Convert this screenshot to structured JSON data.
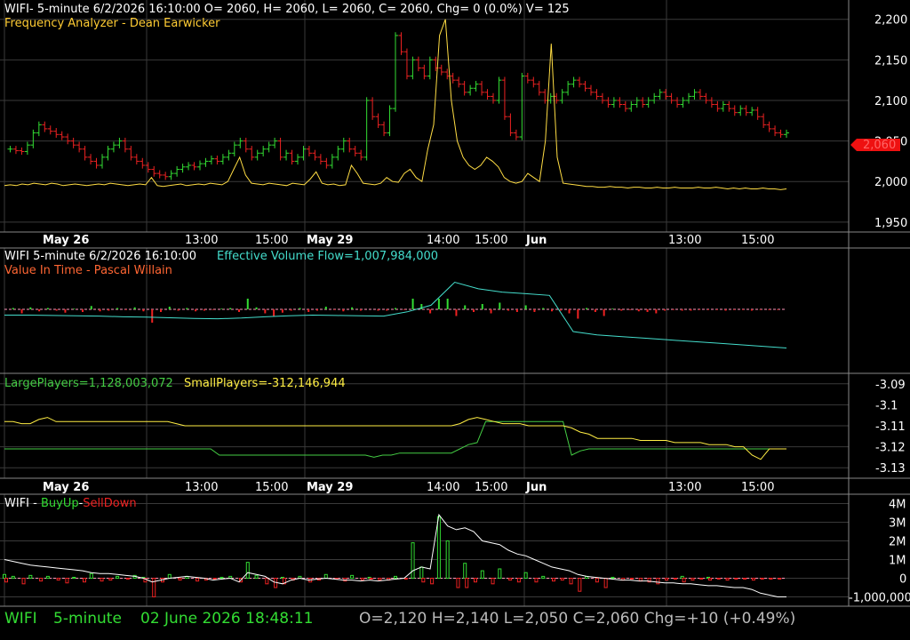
{
  "colors": {
    "background": "#000000",
    "up": "#33dd33",
    "down": "#ee2222",
    "grid": "#3a3a3a",
    "axis_text": "#ffffff",
    "freq": "#ffdd44",
    "flow": "#44ddcc",
    "value_in_time": "#ff6633",
    "large": "#44cc44",
    "small": "#ffee44",
    "buyup": "#33dd33",
    "selldown": "#ee2222",
    "cumulative": "#ffffff",
    "status_green": "#33dd33",
    "status_grey": "#bbbbbb",
    "price_tag": "#ee1111"
  },
  "panel1": {
    "header": "WIFI- 5-minute 6/2/2026 16:10:00 O= 2060, H= 2060, L= 2060, C= 2060, Chg= 0 (0.0%) V= 125",
    "indicator": "Frequency Analyzer - Dean Earwicker",
    "price_tag": "2,060",
    "y_ticks": [
      "2,200",
      "2,150",
      "2,100",
      "2,050",
      "2,000",
      "1,950"
    ]
  },
  "time_axis": {
    "major": [
      "May 26",
      "May 29",
      "Jun"
    ],
    "minor": [
      "13:00",
      "15:00",
      "14:00",
      "15:00",
      "13:00",
      "15:00"
    ]
  },
  "panel2": {
    "header_left": "WIFI 5-minute  6/2/2026 16:10:00",
    "header_right": "Effective Volume Flow=1,007,984,000",
    "indicator": "Value In Time - Pascal Willain"
  },
  "panel3": {
    "large_label": "LargePlayers=1,128,003,072",
    "small_label": "SmallPlayers=-312,146,944",
    "y_ticks": [
      "-3.09",
      "-3.1",
      "-3.11",
      "-3.12",
      "-3.13"
    ]
  },
  "panel4": {
    "header_prefix": "WIFI - ",
    "buy_label": "BuyUp",
    "dash": "-",
    "sell_label": "SellDown",
    "y_ticks": [
      "4M",
      "3M",
      "2M",
      "1M",
      "0",
      "-1,000,000"
    ]
  },
  "status": {
    "symbol": "WIFI",
    "interval": "5-minute",
    "datetime": "02 June 2026 18:48:11",
    "ohlc": "O=2,120  H=2,140  L=2,050  C=2,060  Chg=+10 (+0.49%)"
  },
  "chart_data": [
    {
      "type": "ohlc",
      "title": "WIFI 5-minute",
      "ylim": [
        1940,
        2215
      ],
      "x_labels": [
        "May 26",
        "13:00",
        "15:00",
        "May 29",
        "14:00",
        "15:00",
        "Jun",
        "13:00",
        "15:00"
      ],
      "close_series": [
        2040,
        2040,
        2038,
        2037,
        2045,
        2060,
        2070,
        2065,
        2062,
        2058,
        2055,
        2050,
        2045,
        2040,
        2030,
        2025,
        2020,
        2030,
        2040,
        2045,
        2050,
        2040,
        2030,
        2025,
        2020,
        2015,
        2010,
        2008,
        2006,
        2010,
        2015,
        2018,
        2020,
        2018,
        2022,
        2025,
        2028,
        2025,
        2030,
        2035,
        2045,
        2050,
        2040,
        2030,
        2035,
        2040,
        2045,
        2050,
        2030,
        2035,
        2025,
        2030,
        2040,
        2035,
        2030,
        2025,
        2020,
        2030,
        2040,
        2050,
        2040,
        2035,
        2030,
        2100,
        2080,
        2070,
        2060,
        2090,
        2180,
        2160,
        2130,
        2150,
        2140,
        2130,
        2150,
        2140,
        2135,
        2130,
        2125,
        2120,
        2110,
        2115,
        2120,
        2110,
        2105,
        2100,
        2125,
        2080,
        2060,
        2055,
        2130,
        2125,
        2120,
        2110,
        2100,
        2105,
        2100,
        2110,
        2120,
        2125,
        2120,
        2115,
        2110,
        2105,
        2100,
        2095,
        2100,
        2095,
        2090,
        2095,
        2100,
        2095,
        2100,
        2105,
        2110,
        2105,
        2100,
        2095,
        2100,
        2105,
        2110,
        2105,
        2100,
        2095,
        2090,
        2095,
        2090,
        2085,
        2090,
        2085,
        2088,
        2080,
        2070,
        2065,
        2060,
        2058,
        2060
      ],
      "freq_series": [
        1995,
        1996,
        1995,
        1997,
        1996,
        1998,
        1997,
        1996,
        1998,
        1997,
        1995,
        1996,
        1997,
        1996,
        1995,
        1996,
        1997,
        1996,
        1998,
        1997,
        1996,
        1995,
        1996,
        1997,
        1996,
        2005,
        1995,
        1994,
        1995,
        1996,
        1997,
        1995,
        1996,
        1997,
        1996,
        1998,
        1997,
        1996,
        2000,
        2015,
        2030,
        2008,
        1998,
        1997,
        1996,
        1998,
        1997,
        1996,
        1995,
        1998,
        1997,
        1996,
        2003,
        2012,
        1998,
        1996,
        1997,
        1995,
        1996,
        2020,
        2010,
        1998,
        1997,
        1996,
        1998,
        2005,
        2000,
        1999,
        2010,
        2015,
        2005,
        2000,
        2040,
        2070,
        2180,
        2200,
        2100,
        2050,
        2030,
        2020,
        2015,
        2020,
        2030,
        2025,
        2018,
        2005,
        2000,
        1998,
        2000,
        2010,
        2005,
        2000,
        2050,
        2170,
        2030,
        1998,
        1997,
        1996,
        1995,
        1994,
        1994,
        1993,
        1993,
        1994,
        1993,
        1993,
        1992,
        1993,
        1993,
        1992,
        1992,
        1993,
        1992,
        1992,
        1993,
        1992,
        1992,
        1992,
        1993,
        1992,
        1992,
        1993,
        1992,
        1991,
        1992,
        1991,
        1992,
        1991,
        1991,
        1992,
        1991,
        1991,
        1990,
        1991
      ]
    },
    {
      "type": "line",
      "title": "Effective Volume Flow",
      "series": [
        {
          "name": "Effective Volume Flow",
          "values": [
            1050000000.0,
            1050000000.0,
            1049000000.0,
            1048000000.0,
            1047000000.0,
            1045000000.0,
            1044000000.0,
            1042000000.0,
            1040000000.0,
            1039000000.0,
            1041000000.0,
            1045000000.0,
            1048000000.0,
            1050000000.0,
            1049000000.0,
            1048000000.0,
            1047000000.0,
            1060000000.0,
            1080000000.0,
            1150000000.0,
            1130000000.0,
            1120000000.0,
            1115000000.0,
            1110000000.0,
            1000000000.0,
            990000000.0,
            985000000.0,
            980000000.0,
            975000000.0,
            970000000.0,
            965000000.0,
            960000000.0,
            955000000.0,
            950000000.0
          ]
        }
      ]
    },
    {
      "type": "line",
      "title": "LargePlayers / SmallPlayers",
      "ylim": [
        -3.135,
        -3.085
      ],
      "series": [
        {
          "name": "LargePlayers",
          "values": [
            -3.121,
            -3.121,
            -3.121,
            -3.121,
            -3.121,
            -3.121,
            -3.121,
            -3.121,
            -3.121,
            -3.121,
            -3.121,
            -3.121,
            -3.121,
            -3.121,
            -3.121,
            -3.121,
            -3.121,
            -3.121,
            -3.121,
            -3.121,
            -3.121,
            -3.121,
            -3.121,
            -3.121,
            -3.121,
            -3.124,
            -3.124,
            -3.124,
            -3.124,
            -3.124,
            -3.124,
            -3.124,
            -3.124,
            -3.124,
            -3.124,
            -3.124,
            -3.124,
            -3.124,
            -3.124,
            -3.124,
            -3.124,
            -3.124,
            -3.124,
            -3.125,
            -3.124,
            -3.124,
            -3.123,
            -3.123,
            -3.123,
            -3.123,
            -3.123,
            -3.123,
            -3.123,
            -3.121,
            -3.119,
            -3.118,
            -3.108,
            -3.108,
            -3.108,
            -3.108,
            -3.108,
            -3.108,
            -3.108,
            -3.108,
            -3.108,
            -3.108,
            -3.124,
            -3.122,
            -3.121,
            -3.121,
            -3.121,
            -3.121,
            -3.121,
            -3.121,
            -3.121,
            -3.121,
            -3.121,
            -3.121,
            -3.121,
            -3.121,
            -3.121,
            -3.121,
            -3.121,
            -3.121,
            -3.121,
            -3.121,
            -3.121,
            -3.121,
            -3.121,
            -3.121,
            -3.121,
            -3.121
          ]
        },
        {
          "name": "SmallPlayers",
          "values": [
            -3.108,
            -3.108,
            -3.109,
            -3.109,
            -3.107,
            -3.106,
            -3.108,
            -3.108,
            -3.108,
            -3.108,
            -3.108,
            -3.108,
            -3.108,
            -3.108,
            -3.108,
            -3.108,
            -3.108,
            -3.108,
            -3.108,
            -3.108,
            -3.109,
            -3.11,
            -3.11,
            -3.11,
            -3.11,
            -3.11,
            -3.11,
            -3.11,
            -3.11,
            -3.11,
            -3.11,
            -3.11,
            -3.11,
            -3.11,
            -3.11,
            -3.11,
            -3.11,
            -3.11,
            -3.11,
            -3.11,
            -3.11,
            -3.11,
            -3.11,
            -3.11,
            -3.11,
            -3.11,
            -3.11,
            -3.11,
            -3.11,
            -3.11,
            -3.11,
            -3.11,
            -3.11,
            -3.109,
            -3.107,
            -3.106,
            -3.107,
            -3.108,
            -3.109,
            -3.109,
            -3.109,
            -3.11,
            -3.11,
            -3.11,
            -3.11,
            -3.11,
            -3.111,
            -3.113,
            -3.114,
            -3.116,
            -3.116,
            -3.116,
            -3.116,
            -3.116,
            -3.117,
            -3.117,
            -3.117,
            -3.117,
            -3.118,
            -3.118,
            -3.118,
            -3.118,
            -3.119,
            -3.119,
            -3.119,
            -3.12,
            -3.12,
            -3.124,
            -3.126,
            -3.121,
            -3.121,
            -3.121
          ]
        }
      ]
    },
    {
      "type": "bar",
      "title": "BuyUp-SellDown",
      "ylim": [
        -1500000,
        4500000
      ],
      "series": [
        {
          "name": "BuyUp",
          "values": [
            200000,
            100000,
            0,
            150000,
            0,
            100000,
            0,
            0,
            50000,
            0,
            250000,
            0,
            0,
            100000,
            0,
            150000,
            50000,
            0,
            0,
            200000,
            0,
            100000,
            0,
            0,
            0,
            50000,
            100000,
            0,
            850000,
            150000,
            0,
            0,
            50000,
            0,
            100000,
            0,
            0,
            200000,
            0,
            0,
            150000,
            0,
            50000,
            0,
            0,
            100000,
            0,
            1900000,
            600000,
            0,
            3300000,
            2000000,
            0,
            800000,
            0,
            400000,
            0,
            500000,
            0,
            0,
            300000,
            0,
            100000,
            0,
            0,
            0,
            0,
            100000,
            0,
            0,
            50000,
            0,
            0,
            0,
            0,
            0,
            0,
            0,
            100000,
            0,
            0,
            50000,
            0,
            0,
            0,
            0,
            0,
            0,
            0,
            0,
            0
          ]
        },
        {
          "name": "SellDown",
          "values": [
            -200000,
            0,
            -300000,
            0,
            -150000,
            0,
            -100000,
            -250000,
            0,
            -200000,
            0,
            -150000,
            -100000,
            0,
            -50000,
            0,
            -200000,
            -1000000,
            -200000,
            0,
            -100000,
            0,
            -150000,
            -100000,
            -50000,
            0,
            0,
            -200000,
            0,
            0,
            -300000,
            -500000,
            -300000,
            -100000,
            0,
            -200000,
            -100000,
            0,
            -50000,
            -150000,
            0,
            -100000,
            -50000,
            -100000,
            -100000,
            0,
            -50000,
            0,
            -200000,
            -300000,
            0,
            0,
            -500000,
            -500000,
            -200000,
            0,
            -300000,
            0,
            -100000,
            -200000,
            0,
            -200000,
            0,
            -150000,
            -100000,
            -300000,
            -700000,
            0,
            -200000,
            -500000,
            0,
            -100000,
            -50000,
            -150000,
            -200000,
            -300000,
            -100000,
            -50000,
            -200000,
            -100000,
            -50000,
            -100000,
            -50000,
            -100000,
            -50000,
            -50000,
            -100000,
            -50000,
            -50000,
            -50000,
            0
          ]
        },
        {
          "name": "Cumulative",
          "values": [
            1000000,
            900000,
            800000,
            700000,
            650000,
            600000,
            550000,
            500000,
            450000,
            400000,
            300000,
            250000,
            250000,
            200000,
            150000,
            100000,
            0,
            -200000,
            -100000,
            0,
            50000,
            100000,
            50000,
            0,
            -100000,
            -50000,
            0,
            -200000,
            300000,
            200000,
            100000,
            -200000,
            -300000,
            -100000,
            0,
            -100000,
            -50000,
            0,
            -50000,
            -100000,
            -100000,
            -150000,
            -100000,
            -150000,
            -100000,
            -50000,
            0,
            400000,
            600000,
            500000,
            3400000,
            2800000,
            2600000,
            2700000,
            2500000,
            2000000,
            1900000,
            1800000,
            1500000,
            1300000,
            1200000,
            1000000,
            800000,
            600000,
            500000,
            400000,
            200000,
            100000,
            50000,
            0,
            -50000,
            -100000,
            -100000,
            -150000,
            -150000,
            -200000,
            -250000,
            -250000,
            -300000,
            -300000,
            -350000,
            -400000,
            -400000,
            -450000,
            -500000,
            -500000,
            -600000,
            -800000,
            -900000,
            -1000000,
            -1000000
          ]
        }
      ]
    }
  ]
}
